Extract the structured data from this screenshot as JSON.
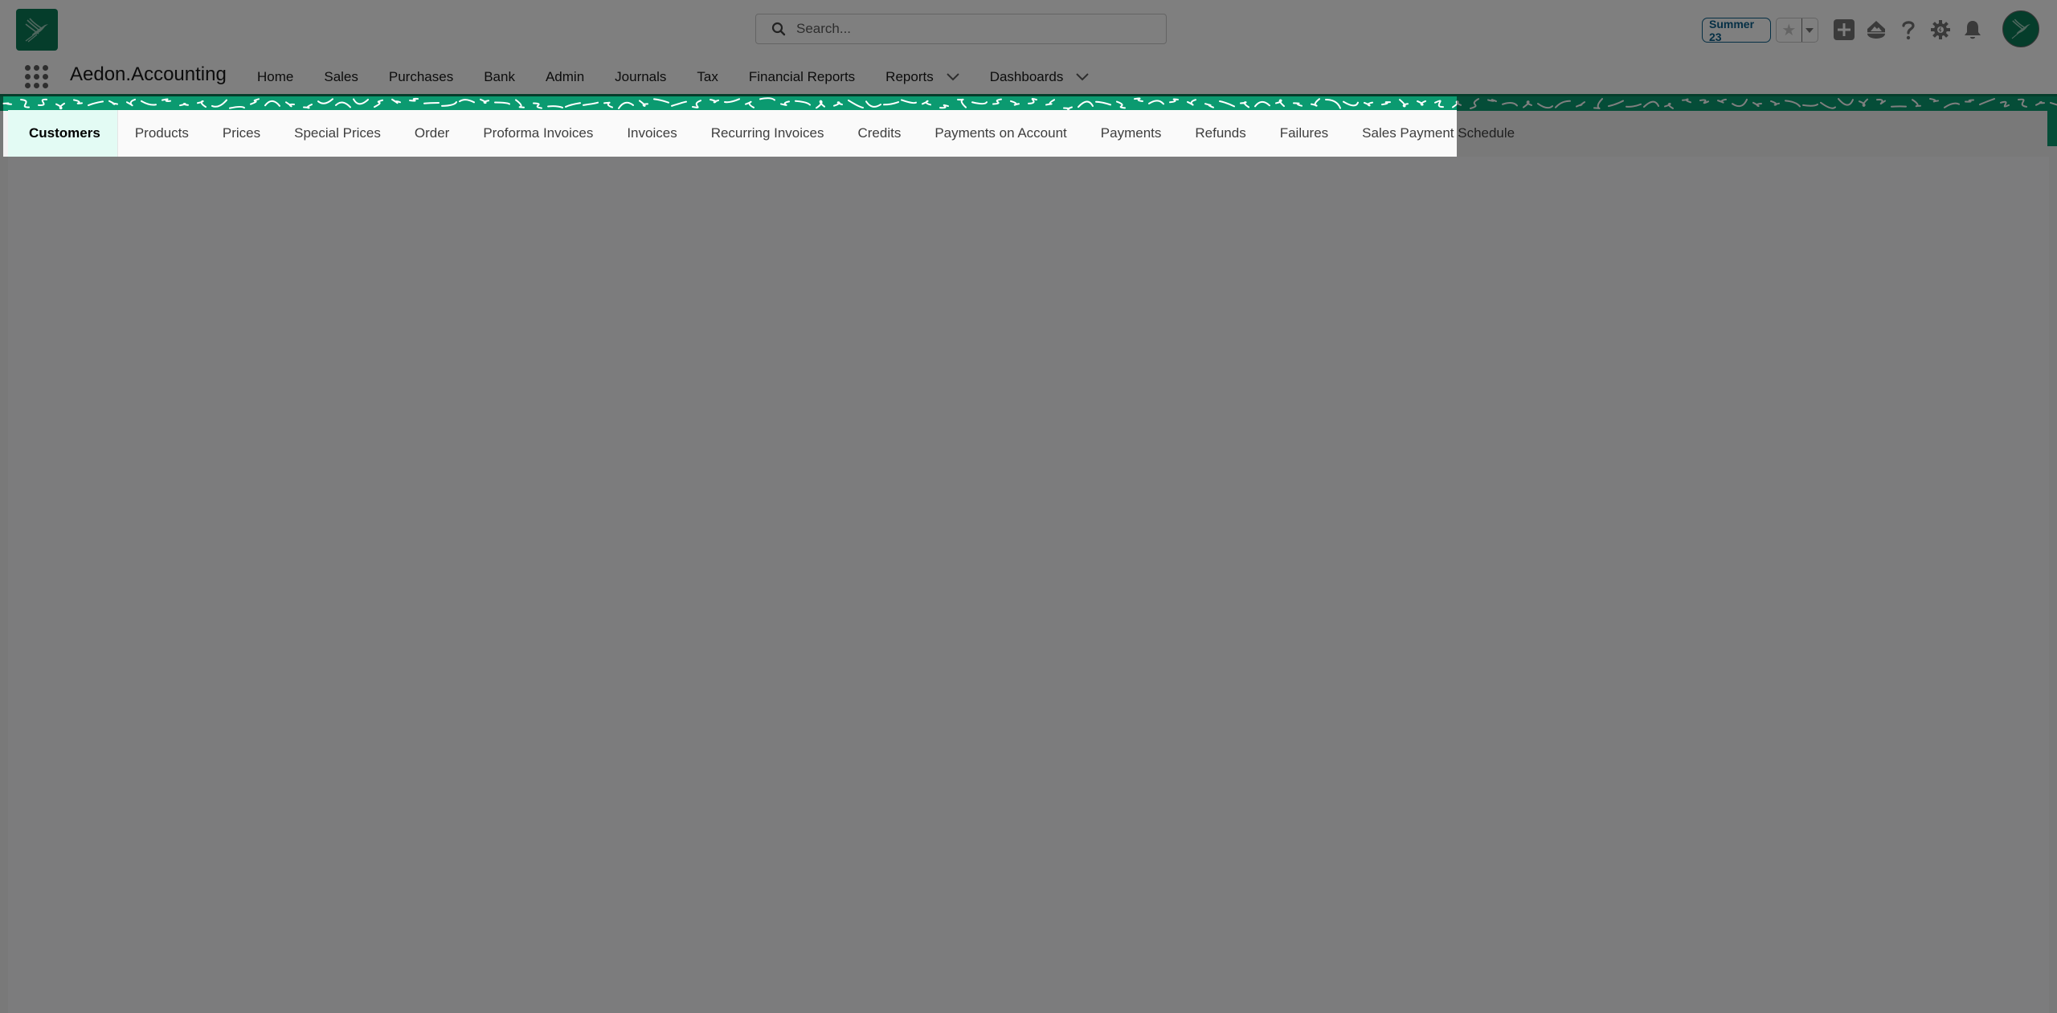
{
  "header": {
    "logo": "aedon-hummingbird-logo",
    "search": {
      "placeholder": "Search...",
      "value": ""
    },
    "release_badge": "Summer 23",
    "icons": [
      "favorites-star-icon",
      "favorites-dropdown-icon",
      "global-actions-add-icon",
      "trailhead-icon",
      "help-icon",
      "setup-gear-icon",
      "notifications-bell-icon",
      "user-avatar"
    ]
  },
  "app_nav": {
    "app_name": "Aedon.Accounting",
    "items": [
      {
        "label": "Home",
        "has_menu": false
      },
      {
        "label": "Sales",
        "has_menu": false
      },
      {
        "label": "Purchases",
        "has_menu": false
      },
      {
        "label": "Bank",
        "has_menu": false
      },
      {
        "label": "Admin",
        "has_menu": false
      },
      {
        "label": "Journals",
        "has_menu": false
      },
      {
        "label": "Tax",
        "has_menu": false
      },
      {
        "label": "Financial Reports",
        "has_menu": false
      },
      {
        "label": "Reports",
        "has_menu": true
      },
      {
        "label": "Dashboards",
        "has_menu": true
      }
    ]
  },
  "sub_tabs": {
    "active": "Customers",
    "items": [
      "Customers",
      "Products",
      "Prices",
      "Special Prices",
      "Order",
      "Proforma Invoices",
      "Invoices",
      "Recurring Invoices",
      "Credits",
      "Payments on Account",
      "Payments",
      "Refunds",
      "Failures",
      "Sales Payment Schedule"
    ]
  },
  "colors": {
    "brand_green": "#0b7a57",
    "pattern_green": "#0b9a70",
    "active_tab_bg": "#e3fbf4",
    "badge_blue": "#0b5f8a",
    "overlay": "rgba(0,0,0,0.5)"
  }
}
